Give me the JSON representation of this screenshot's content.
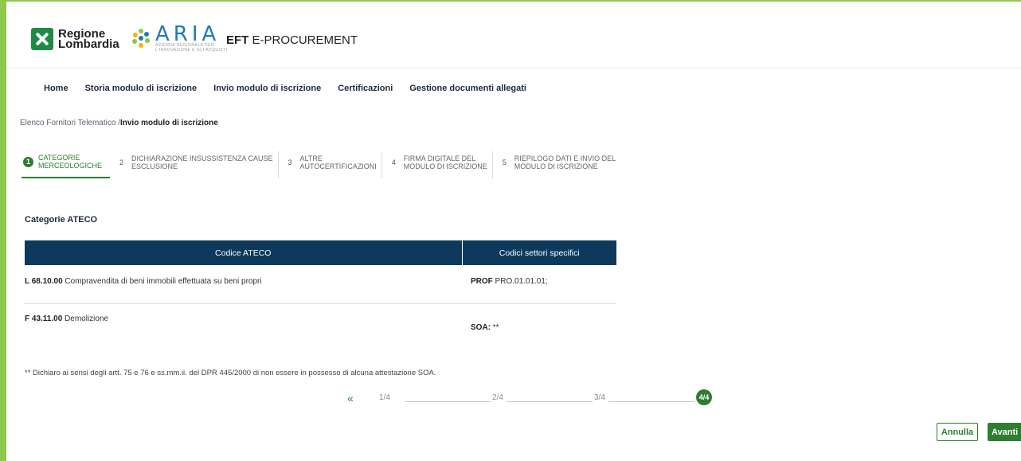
{
  "header": {
    "region_logo_line1": "Regione",
    "region_logo_line2": "Lombardia",
    "aria_logo_word": "ARIA",
    "aria_logo_sub1": "AZIENDA REGIONALE PER",
    "aria_logo_sub2": "L'INNOVAZIONE E GLI ACQUISTI",
    "app_title_bold": "EFT",
    "app_title_rest": " E-PROCUREMENT"
  },
  "nav": {
    "items": [
      {
        "label": "Home"
      },
      {
        "label": "Storia modulo di iscrizione"
      },
      {
        "label": "Invio modulo di iscrizione"
      },
      {
        "label": "Certificazioni"
      },
      {
        "label": "Gestione documenti allegati"
      }
    ]
  },
  "breadcrumb": {
    "parent": "Elenco Fornitori Telematico /",
    "current": "Invio modulo di iscrizione"
  },
  "steps": [
    {
      "num": "1",
      "line1": "CATEGORIE",
      "line2": "MERCEOLOGICHE"
    },
    {
      "num": "2",
      "line1": "DICHIARAZIONE INSUSSISTENZA CAUSE",
      "line2": "ESCLUSIONE"
    },
    {
      "num": "3",
      "line1": "ALTRE",
      "line2": "AUTOCERTIFICAZIONI"
    },
    {
      "num": "4",
      "line1": "FIRMA DIGITALE DEL",
      "line2": "MODULO DI ISCRIZIONE"
    },
    {
      "num": "5",
      "line1": "RIEPILOGO DATI E INVIO DEL",
      "line2": "MODULO DI ISCRIZIONE"
    }
  ],
  "section": {
    "title": "Categorie ATECO"
  },
  "table": {
    "headers": [
      "Codice ATECO",
      "Codici settori specifici"
    ],
    "rows": [
      {
        "code": "L 68.10.00",
        "description": " Compravendita di beni immobili effettuata su beni propri",
        "sector_label": "PROF",
        "sector_value": " PRO.01.01.01;"
      },
      {
        "code": "F 43.11.00",
        "description": " Demolizione",
        "sector_label": "SOA:",
        "sector_value": " **"
      }
    ]
  },
  "footnote": "** Dichiaro ai sensi degli artt. 75 e 76 e ss.mm.ii. del DPR 445/2000 di non essere in possesso di alcuna attestazione SOA.",
  "pagination": {
    "prev": "«",
    "pages": [
      "1/4",
      "2/4",
      "3/4"
    ],
    "current": "4/4"
  },
  "buttons": {
    "cancel": "Annulla",
    "next": "Avanti"
  },
  "colors": {
    "accent_green": "#2e7d32",
    "table_header_navy": "#0d3a5c",
    "frame_green": "#8fc94a"
  }
}
